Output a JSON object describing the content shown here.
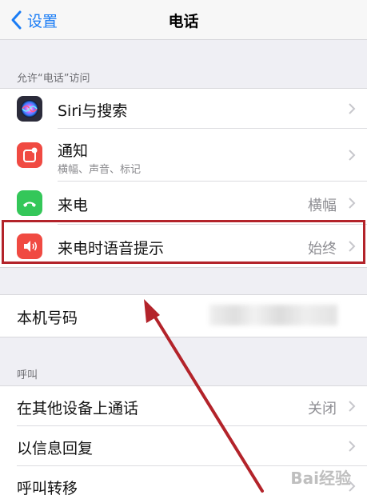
{
  "navbar": {
    "back_label": "设置",
    "title": "电话"
  },
  "sections": {
    "allow_access": "允许“电话”访问",
    "calls": "呼叫"
  },
  "access_rows": {
    "siri": {
      "title": "Siri与搜索"
    },
    "notifications": {
      "title": "通知",
      "subtitle": "横幅、声音、标记"
    },
    "incoming_call": {
      "title": "来电",
      "value": "横幅"
    },
    "announce_calls": {
      "title": "来电时语音提示",
      "value": "始终"
    }
  },
  "my_number": {
    "title": "本机号码"
  },
  "call_rows": {
    "other_devices": {
      "title": "在其他设备上通话",
      "value": "关闭"
    },
    "respond_with_text": {
      "title": "以信息回复"
    },
    "call_forwarding": {
      "title": "呼叫转移"
    }
  },
  "watermark": "Bai经验",
  "colors": {
    "accent": "#1a7cf5",
    "siri": "#2b2b3a",
    "notifications": "#f04a42",
    "incoming_call": "#34c759",
    "announce": "#f04a42",
    "highlight": "#b3232a"
  }
}
